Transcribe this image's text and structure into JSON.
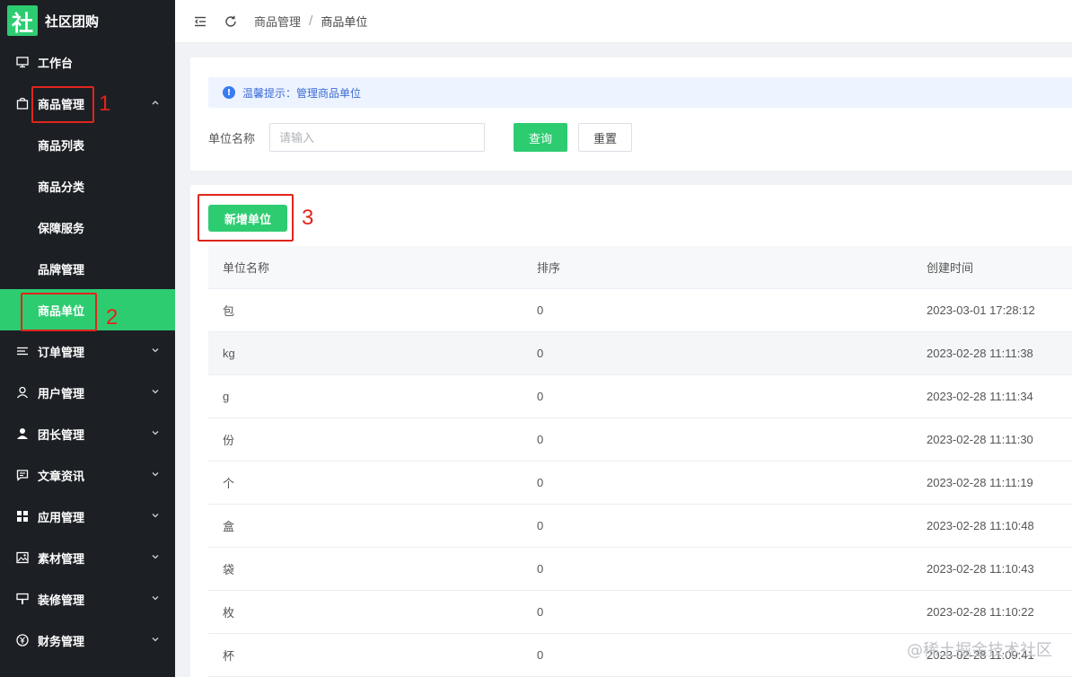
{
  "app": {
    "logo_char": "社",
    "title": "社区团购"
  },
  "sidebar": {
    "items": [
      {
        "label": "工作台",
        "icon": "monitor-icon",
        "caret": ""
      },
      {
        "label": "商品管理",
        "icon": "bag-icon",
        "caret": "up"
      },
      {
        "label": "订单管理",
        "icon": "list-icon",
        "caret": "down"
      },
      {
        "label": "用户管理",
        "icon": "user-icon",
        "caret": "down"
      },
      {
        "label": "团长管理",
        "icon": "user-solid-icon",
        "caret": "down"
      },
      {
        "label": "文章资讯",
        "icon": "chat-icon",
        "caret": "down"
      },
      {
        "label": "应用管理",
        "icon": "grid-icon",
        "caret": "down"
      },
      {
        "label": "素材管理",
        "icon": "image-icon",
        "caret": "down"
      },
      {
        "label": "装修管理",
        "icon": "brush-icon",
        "caret": "down"
      },
      {
        "label": "财务管理",
        "icon": "yen-icon",
        "caret": "down"
      }
    ],
    "submenu": [
      {
        "label": "商品列表"
      },
      {
        "label": "商品分类"
      },
      {
        "label": "保障服务"
      },
      {
        "label": "品牌管理"
      },
      {
        "label": "商品单位",
        "active": true
      }
    ]
  },
  "topbar": {
    "breadcrumb": [
      "商品管理",
      "商品单位"
    ],
    "separator": "/"
  },
  "tip": {
    "text": "温馨提示：管理商品单位"
  },
  "search": {
    "label": "单位名称",
    "placeholder": "请输入",
    "value": "",
    "query_label": "查询",
    "reset_label": "重置"
  },
  "actions": {
    "add_label": "新增单位"
  },
  "table": {
    "headers": [
      "单位名称",
      "排序",
      "创建时间"
    ],
    "rows": [
      [
        "包",
        "0",
        "2023-03-01 17:28:12"
      ],
      [
        "kg",
        "0",
        "2023-02-28 11:11:38"
      ],
      [
        "g",
        "0",
        "2023-02-28 11:11:34"
      ],
      [
        "份",
        "0",
        "2023-02-28 11:11:30"
      ],
      [
        "个",
        "0",
        "2023-02-28 11:11:19"
      ],
      [
        "盒",
        "0",
        "2023-02-28 11:10:48"
      ],
      [
        "袋",
        "0",
        "2023-02-28 11:10:43"
      ],
      [
        "枚",
        "0",
        "2023-02-28 11:10:22"
      ],
      [
        "杯",
        "0",
        "2023-02-28 11:09:41"
      ]
    ]
  },
  "annotations": [
    "1",
    "2",
    "3"
  ],
  "watermark": "@稀土掘金技术社区",
  "colors": {
    "accent": "#2ecc71",
    "sidebar_bg": "#1c1f24",
    "annotation": "#e0251b",
    "tip_bg": "#eef4ff",
    "tip_text": "#3a6ad6"
  }
}
